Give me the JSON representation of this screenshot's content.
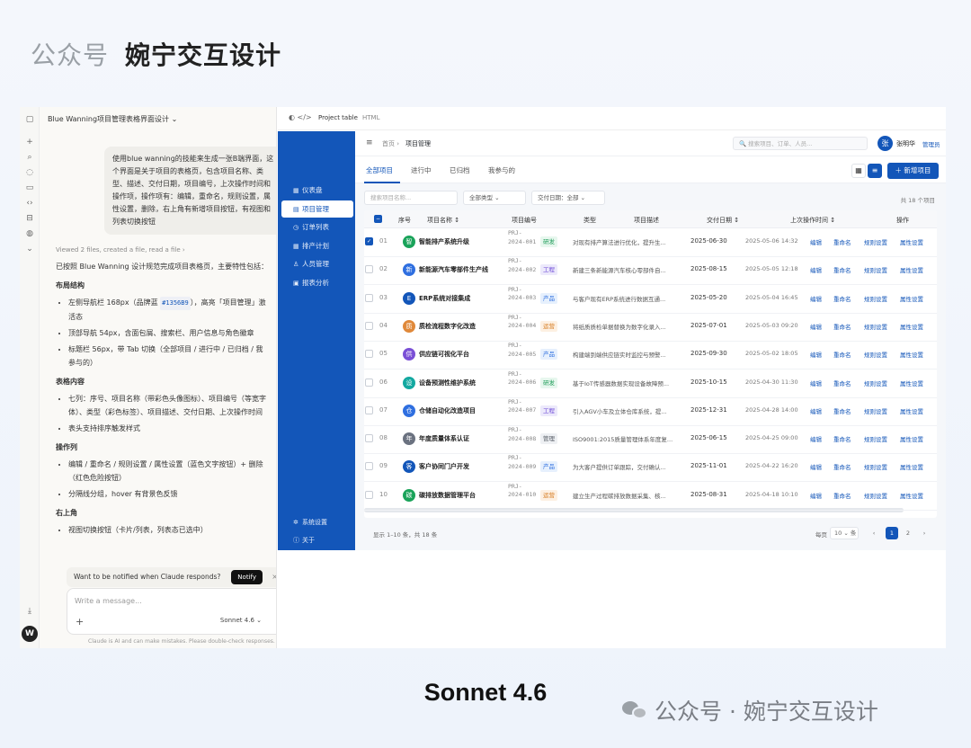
{
  "header": {
    "a": "公众号",
    "b": "婉宁交互设计"
  },
  "chat": {
    "title": "Blue Wanning项目管理表格界面设计 ⌄",
    "user_message": "使用blue wanning的技能来生成一张B端界面，这个界面是关于项目的表格页，包含项目名称、类型、描述、交付日期，项目编号，上次操作时间和操作项，操作项有：编辑，重命名，规则设置，属性设置，删除，右上角有新增项目按钮，有视图和列表切换按钮",
    "viewed": "Viewed 2 files, created a file, read a file  ›",
    "intro": "已按照 Blue Wanning 设计规范完成项目表格页，主要特性包括：",
    "sections": [
      {
        "title": "布局结构",
        "items": [
          {
            "pre": "左侧导航栏 168px（品牌蓝 ",
            "chip": "#1356B9",
            "post": "），高亮「项目管理」激活态"
          },
          {
            "pre": "顶部导航 54px，含面包屑、搜索栏、用户信息与角色徽章",
            "chip": "",
            "post": ""
          },
          {
            "pre": "标题栏 56px，带 Tab 切换（全部项目 / 进行中 / 已归档 / 我参与的）",
            "chip": "",
            "post": ""
          }
        ]
      },
      {
        "title": "表格内容",
        "items": [
          {
            "pre": "七列：序号、项目名称（带彩色头像图标）、项目编号（等宽字体）、类型（彩色标签）、项目描述、交付日期、上次操作时间",
            "chip": "",
            "post": ""
          },
          {
            "pre": "表头支持排序触发样式",
            "chip": "",
            "post": ""
          }
        ]
      },
      {
        "title": "操作列",
        "items": [
          {
            "pre": "编辑 / 重命名 / 规则设置 / 属性设置（蓝色文字按钮）+ 删除（红色危险按钮）",
            "chip": "",
            "post": ""
          },
          {
            "pre": "分隔线分组，hover 有背景色反馈",
            "chip": "",
            "post": ""
          }
        ]
      },
      {
        "title": "右上角",
        "items": [
          {
            "pre": "视图切换按钮（卡片/列表，列表态已选中）",
            "chip": "",
            "post": ""
          }
        ]
      }
    ],
    "notify_text": "Want to be notified when Claude responds?",
    "notify_btn": "Notify",
    "notify_close": "×",
    "input_placeholder": "Write a message...",
    "plus": "+",
    "model": "Sonnet 4.6  ⌄",
    "wave": "𝄃𝄃",
    "disclaimer": "Claude is AI and can make mistakes. Please double-check responses.",
    "avatar": "W"
  },
  "artifact": {
    "icon": "◐ </>",
    "title": "Project table",
    "type": "HTML"
  },
  "app": {
    "sidebar": [
      {
        "icon": "▦",
        "label": "仪表盘"
      },
      {
        "icon": "▤",
        "label": "项目管理"
      },
      {
        "icon": "◷",
        "label": "订单列表"
      },
      {
        "icon": "▦",
        "label": "排产计划"
      },
      {
        "icon": "♙",
        "label": "人员管理"
      },
      {
        "icon": "▣",
        "label": "报表分析"
      }
    ],
    "sidebar_bottom": [
      {
        "icon": "✲",
        "label": "系统设置"
      },
      {
        "icon": "ⓘ",
        "label": "关于"
      }
    ],
    "menu_icon": "≡",
    "crumb_home": "首页  ›",
    "crumb_current": "项目管理",
    "search_placeholder": "🔍 搜索项目、订单、人员...",
    "user_avatar": "张",
    "user_name": "张明华",
    "user_role": "管理员",
    "tabs": [
      "全部项目",
      "进行中",
      "已归档",
      "我参与的"
    ],
    "view_grid": "▦",
    "view_list": "≡",
    "new_button": "＋ 新增项目",
    "filter_search": "搜索项目名称...",
    "filter_type": "全部类型      ⌄",
    "filter_date": "交付日期：全部    ⌄",
    "total": "共 18 个项目",
    "columns": {
      "seq": "序号",
      "name": "项目名称 ↕",
      "code": "项目编号",
      "type": "类型",
      "desc": "项目描述",
      "date": "交付日期 ↕",
      "last": "上次操作时间 ↕",
      "ops": "操作"
    },
    "rows": [
      {
        "n": "01",
        "av": "智",
        "avc": "#1aa35a",
        "name": "智能排产系统升级",
        "code": "PRJ-2024-001",
        "type": "研发",
        "desc": "对现有排产算法进行优化，提升生...",
        "date": "2025-06-30",
        "last": "2025-05-06 14:32",
        "checked": "✓"
      },
      {
        "n": "02",
        "av": "新",
        "avc": "#2f6fe0",
        "name": "新能源汽车零部件生产线",
        "code": "PRJ-2024-002",
        "type": "工程",
        "desc": "新建三条新能源汽车核心零部件自...",
        "date": "2025-08-15",
        "last": "2025-05-05 12:18",
        "checked": ""
      },
      {
        "n": "03",
        "av": "E",
        "avc": "#1356B9",
        "name": "ERP系统对接集成",
        "code": "PRJ-2024-003",
        "type": "产品",
        "desc": "与客户现有ERP系统进行数据互通...",
        "date": "2025-05-20",
        "last": "2025-05-04 16:45",
        "checked": ""
      },
      {
        "n": "04",
        "av": "质",
        "avc": "#e0893a",
        "name": "质检流程数字化改造",
        "code": "PRJ-2024-004",
        "type": "运营",
        "desc": "将纸质质检单据替换为数字化录入...",
        "date": "2025-07-01",
        "last": "2025-05-03 09:20",
        "checked": ""
      },
      {
        "n": "05",
        "av": "供",
        "avc": "#7a4fd6",
        "name": "供应链可视化平台",
        "code": "PRJ-2024-005",
        "type": "产品",
        "desc": "构建端到端供应链实时监控与预警...",
        "date": "2025-09-30",
        "last": "2025-05-02 18:05",
        "checked": ""
      },
      {
        "n": "06",
        "av": "设",
        "avc": "#13a8a0",
        "name": "设备预测性维护系统",
        "code": "PRJ-2024-006",
        "type": "研发",
        "desc": "基于IoT传感器数据实现设备故障预...",
        "date": "2025-10-15",
        "last": "2025-04-30 11:30",
        "checked": ""
      },
      {
        "n": "07",
        "av": "仓",
        "avc": "#2f6fe0",
        "name": "仓储自动化改造项目",
        "code": "PRJ-2024-007",
        "type": "工程",
        "desc": "引入AGV小车及立体仓库系统，提...",
        "date": "2025-12-31",
        "last": "2025-04-28 14:00",
        "checked": ""
      },
      {
        "n": "08",
        "av": "年",
        "avc": "#6b7280",
        "name": "年度质量体系认证",
        "code": "PRJ-2024-008",
        "type": "管理",
        "desc": "ISO9001:2015质量管理体系年度复...",
        "date": "2025-06-15",
        "last": "2025-04-25 09:00",
        "checked": ""
      },
      {
        "n": "09",
        "av": "客",
        "avc": "#1356B9",
        "name": "客户协同门户开发",
        "code": "PRJ-2024-009",
        "type": "产品",
        "desc": "为大客户提供订单跟踪，交付确认...",
        "date": "2025-11-01",
        "last": "2025-04-22 16:20",
        "checked": ""
      },
      {
        "n": "10",
        "av": "碳",
        "avc": "#1aa35a",
        "name": "碳排放数据管理平台",
        "code": "PRJ-2024-010",
        "type": "运营",
        "desc": "建立生产过程碳排放数据采集、核...",
        "date": "2025-08-31",
        "last": "2025-04-18 10:10",
        "checked": ""
      }
    ],
    "ops": [
      "编辑",
      "重命名",
      "规则设置",
      "属性设置"
    ],
    "pager": {
      "info": "显示 1–10 条，共 18 条",
      "per": "每页",
      "size": "10  ⌄  条",
      "prev": "‹",
      "p1": "1",
      "p2": "2",
      "next": "›"
    }
  },
  "tag_colors": {
    "研发": {
      "bg": "#e7f7ee",
      "fg": "#1a9a55"
    },
    "工程": {
      "bg": "#ece9fb",
      "fg": "#6b46d6"
    },
    "产品": {
      "bg": "#e6f0fd",
      "fg": "#2f6fe0"
    },
    "运营": {
      "bg": "#fdf0e2",
      "fg": "#d57a1e"
    },
    "管理": {
      "bg": "#eef0f3",
      "fg": "#555b65"
    }
  },
  "footer": {
    "model": "Sonnet 4.6",
    "brand": "公众号 · 婉宁交互设计"
  }
}
